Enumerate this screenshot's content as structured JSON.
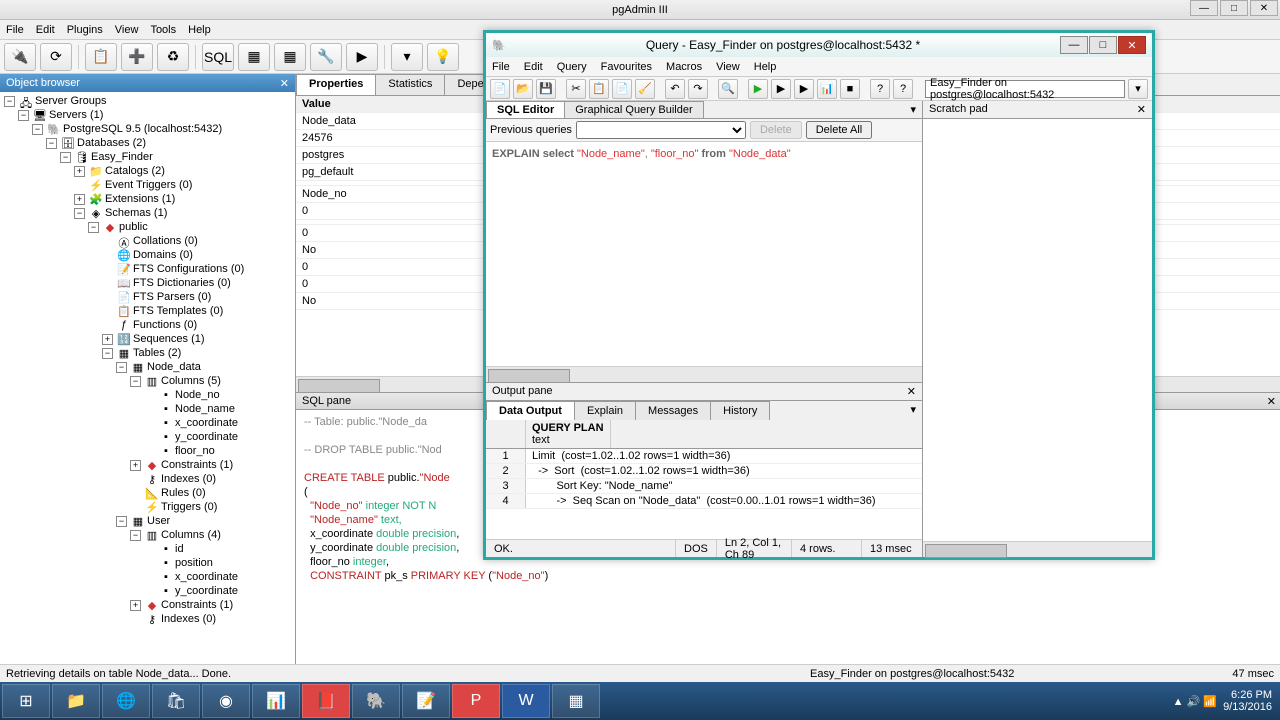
{
  "app": {
    "title": "pgAdmin III"
  },
  "main_menu": [
    "File",
    "Edit",
    "Plugins",
    "View",
    "Tools",
    "Help"
  ],
  "toolbar_icons": [
    "plug",
    "refresh",
    "props",
    "run",
    "trash",
    "sql",
    "grid",
    "filter",
    "wrench",
    "plus",
    "funnel",
    "hint"
  ],
  "object_browser": {
    "title": "Object browser",
    "root": "Server Groups",
    "servers": "Servers (1)",
    "pg": "PostgreSQL 9.5 (localhost:5432)",
    "dbs": "Databases (2)",
    "db": "Easy_Finder",
    "catalogs": "Catalogs (2)",
    "events": "Event Triggers (0)",
    "ext": "Extensions (1)",
    "schemas": "Schemas (1)",
    "public": "public",
    "collations": "Collations (0)",
    "domains": "Domains (0)",
    "fts_conf": "FTS Configurations (0)",
    "fts_dict": "FTS Dictionaries (0)",
    "fts_pars": "FTS Parsers (0)",
    "fts_templ": "FTS Templates (0)",
    "functions": "Functions (0)",
    "sequences": "Sequences (1)",
    "tables": "Tables (2)",
    "node_data": "Node_data",
    "node_cols": "Columns (5)",
    "col_node_no": "Node_no",
    "col_node_name": "Node_name",
    "col_x": "x_coordinate",
    "col_y": "y_coordinate",
    "col_floor": "floor_no",
    "constraints": "Constraints (1)",
    "indexes": "Indexes (0)",
    "rules": "Rules (0)",
    "triggers": "Triggers (0)",
    "user": "User",
    "user_cols": "Columns (4)",
    "col_id": "id",
    "col_pos": "position",
    "col_ux": "x_coordinate",
    "col_uy": "y_coordinate",
    "u_constraints": "Constraints (1)",
    "u_indexes": "Indexes (0)"
  },
  "tabs": {
    "properties": "Properties",
    "statistics": "Statistics",
    "dependencies": "Depen"
  },
  "prop_header": "Value",
  "props": [
    "Node_data",
    "24576",
    "postgres",
    "pg_default",
    "",
    "Node_no",
    "0",
    "",
    "0",
    "No",
    "0",
    "0",
    "No"
  ],
  "sql_pane": {
    "title": "SQL pane",
    "l1": "-- Table: public.\"Node_da",
    "l2": "-- DROP TABLE public.\"Nod",
    "l3a": "CREATE TABLE",
    "l3b": " public.",
    "l3c": "\"Node",
    "l4": "(",
    "l5a": "  \"Node_no\"",
    "l5b": " integer NOT N",
    "l6a": "  \"Node_name\"",
    "l6b": " text,",
    "l7a": "  x_coordinate ",
    "l7b": "double precision",
    "l7c": ",",
    "l8a": "  y_coordinate ",
    "l8b": "double precision",
    "l8c": ",",
    "l9a": "  floor_no ",
    "l9b": "integer",
    "l9c": ",",
    "l10a": "  CONSTRAINT",
    "l10b": " pk_s ",
    "l10c": "PRIMARY KEY",
    "l10d": " (",
    "l10e": "\"Node_no\"",
    "l10f": ")"
  },
  "status": {
    "left": "Retrieving details on table Node_data... Done.",
    "mid": "Easy_Finder on postgres@localhost:5432",
    "right": "47 msec"
  },
  "query": {
    "title": "Query - Easy_Finder on postgres@localhost:5432 *",
    "menu": [
      "File",
      "Edit",
      "Query",
      "Favourites",
      "Macros",
      "View",
      "Help"
    ],
    "combo": "Easy_Finder on postgres@localhost:5432",
    "tab_sql": "SQL Editor",
    "tab_gqb": "Graphical Query Builder",
    "prev_label": "Previous queries",
    "delete": "Delete",
    "delete_all": "Delete All",
    "sql_a": "EXPLAIN select",
    "sql_b": " \"Node_name\"",
    "sql_c": ", ",
    "sql_d": "\"floor_no\"",
    "sql_e": " from ",
    "sql_f": "\"Node_data\"",
    "scratch": "Scratch pad",
    "output_title": "Output pane",
    "out_tabs": {
      "data": "Data Output",
      "explain": "Explain",
      "messages": "Messages",
      "history": "History"
    },
    "col_header1": "QUERY PLAN",
    "col_header2": "text",
    "rows": [
      "Limit  (cost=1.02..1.02 rows=1 width=36)",
      "  ->  Sort  (cost=1.02..1.02 rows=1 width=36)",
      "        Sort Key: \"Node_name\"",
      "        ->  Seq Scan on \"Node_data\"  (cost=0.00..1.01 rows=1 width=36)"
    ],
    "status": {
      "ok": "OK.",
      "enc": "DOS",
      "pos": "Ln 2, Col 1, Ch 89",
      "rows": "4 rows.",
      "time": "13 msec"
    }
  },
  "tray": {
    "time": "6:26 PM",
    "date": "9/13/2016"
  }
}
